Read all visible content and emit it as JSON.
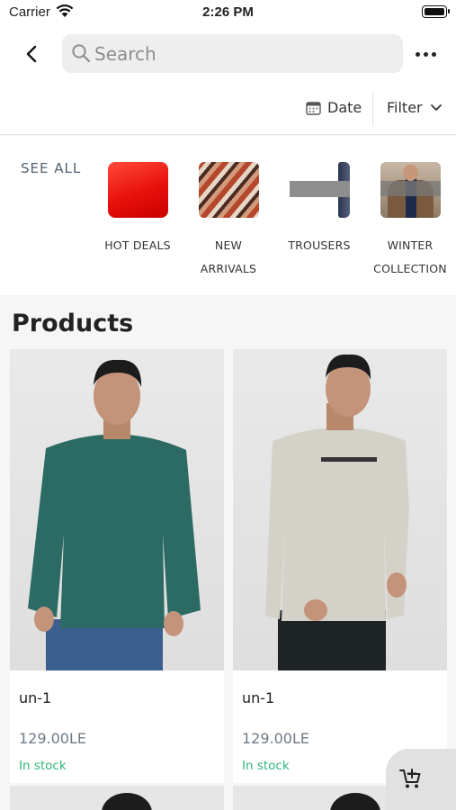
{
  "status_bar": {
    "carrier": "Carrier",
    "time": "2:26 PM"
  },
  "header": {
    "search_placeholder": "Search",
    "sort_label": "Date",
    "filter_label": "Filter"
  },
  "categories": {
    "see_all": "SEE ALL",
    "items": [
      {
        "line1": "HOT DEALS",
        "line2": ""
      },
      {
        "line1": "NEW",
        "line2": "ARRIVALS"
      },
      {
        "line1": "TROUSERS",
        "line2": ""
      },
      {
        "line1": "WINTER",
        "line2": "COLLECTION"
      }
    ]
  },
  "products": {
    "title": "Products",
    "items": [
      {
        "name": "un-1",
        "price": "129.00LE",
        "stock": "In stock",
        "sweater_color": "#2b6b64"
      },
      {
        "name": "un-1",
        "price": "129.00LE",
        "stock": "In stock",
        "sweater_color": "#d4d2c8"
      }
    ]
  },
  "colors": {
    "accent_stock": "#2fb67a",
    "hot_deals": "#e8100a"
  },
  "icons": [
    "wifi-icon",
    "battery-icon",
    "back-chevron-icon",
    "search-icon",
    "more-icon",
    "calendar-icon",
    "chevron-down-icon",
    "add-to-cart-icon"
  ]
}
